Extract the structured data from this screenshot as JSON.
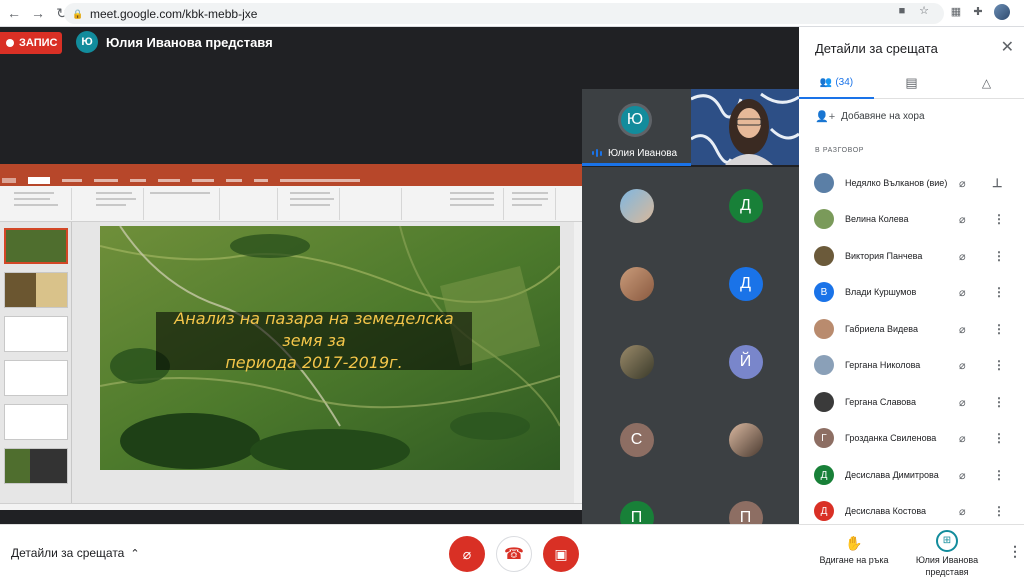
{
  "browser": {
    "url": "meet.google.com/kbk-mebb-jxe"
  },
  "recording": {
    "label": "ЗАПИС"
  },
  "presenter": {
    "initial": "Ю",
    "label": "Юлия Иванова представя"
  },
  "slide": {
    "line1": "Анализ на пазара на земеделска земя за",
    "line2": "периода 2017-2019г."
  },
  "spotlight": {
    "initial": "Ю",
    "name": "Юлия Иванова"
  },
  "grid": {
    "initials": [
      "Д",
      "Д",
      "Й",
      "С",
      "П",
      "П"
    ]
  },
  "panel": {
    "title": "Детайли за срещата",
    "people_count": "(34)",
    "add_people": "Добавяне на хора",
    "in_call": "В РАЗГОВОР",
    "participants": [
      {
        "name": "Недялко Вълканов (вие)",
        "initial": "",
        "color": "#5b7fa6"
      },
      {
        "name": "Велина Колева",
        "initial": "",
        "color": "#7a9a5a"
      },
      {
        "name": "Виктория Панчева",
        "initial": "",
        "color": "#6b5a3a"
      },
      {
        "name": "Влади Куршумов",
        "initial": "В",
        "color": "#1a73e8"
      },
      {
        "name": "Габриела Видева",
        "initial": "",
        "color": "#b98b6e"
      },
      {
        "name": "Гергана Николова",
        "initial": "",
        "color": "#8aa0b8"
      },
      {
        "name": "Гергана Славова",
        "initial": "",
        "color": "#3a3a3a"
      },
      {
        "name": "Грозданка Свиленова",
        "initial": "Г",
        "color": "#8d6e63"
      },
      {
        "name": "Десислава Димитрова",
        "initial": "Д",
        "color": "#188038"
      },
      {
        "name": "Десислава Костова",
        "initial": "Д",
        "color": "#d93025"
      }
    ]
  },
  "bottom": {
    "details": "Детайли за срещата",
    "raise_hand": "Вдигане на ръка",
    "presenting_line1": "Юлия Иванова",
    "presenting_line2": "представя"
  },
  "colors": {
    "accent": "#1a73e8",
    "record": "#d93025",
    "ppt": "#b7472a"
  }
}
